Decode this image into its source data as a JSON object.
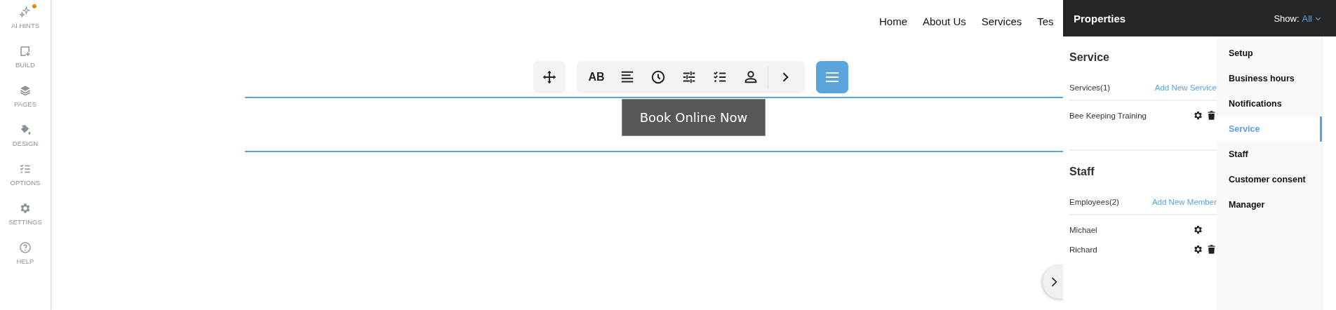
{
  "sidebar": {
    "items": [
      {
        "label": "AI HINTS",
        "kind": "sparkle",
        "badge": true
      },
      {
        "label": "BUILD",
        "kind": "build",
        "badge": false
      },
      {
        "label": "PAGES",
        "kind": "layers",
        "badge": false
      },
      {
        "label": "DESIGN",
        "kind": "bucket",
        "badge": false
      },
      {
        "label": "OPTIONS",
        "kind": "checklist",
        "badge": false
      },
      {
        "label": "SETTINGS",
        "kind": "gear",
        "badge": false
      },
      {
        "label": "HELP",
        "kind": "help",
        "badge": false
      }
    ]
  },
  "site_nav": [
    "Home",
    "About Us",
    "Services",
    "Tes"
  ],
  "toolbar": {
    "tools": [
      {
        "kind": "text",
        "label": "AB"
      },
      {
        "kind": "align"
      },
      {
        "kind": "clock"
      },
      {
        "kind": "sliders"
      },
      {
        "kind": "checklist"
      },
      {
        "kind": "person"
      },
      {
        "kind": "more"
      }
    ]
  },
  "book_button": "Book Online Now",
  "properties": {
    "title": "Properties",
    "show_label": "Show:",
    "show_value": "All",
    "sections": [
      {
        "heading": "Service",
        "count_label": "Services(1)",
        "add_link": "Add New Service",
        "rows": [
          {
            "name": "Bee Keeping Training",
            "deletable": true
          }
        ]
      },
      {
        "heading": "Staff",
        "count_label": "Employees(2)",
        "add_link": "Add New Member",
        "rows": [
          {
            "name": "Michael",
            "deletable": false
          },
          {
            "name": "Richard",
            "deletable": true
          }
        ]
      }
    ],
    "tabs": [
      {
        "label": "Setup",
        "selected": false
      },
      {
        "label": "Business hours",
        "selected": false
      },
      {
        "label": "Notifications",
        "selected": false
      },
      {
        "label": "Service",
        "selected": true
      },
      {
        "label": "Staff",
        "selected": false
      },
      {
        "label": "Customer consent",
        "selected": false
      },
      {
        "label": "Manager",
        "selected": false
      }
    ]
  }
}
